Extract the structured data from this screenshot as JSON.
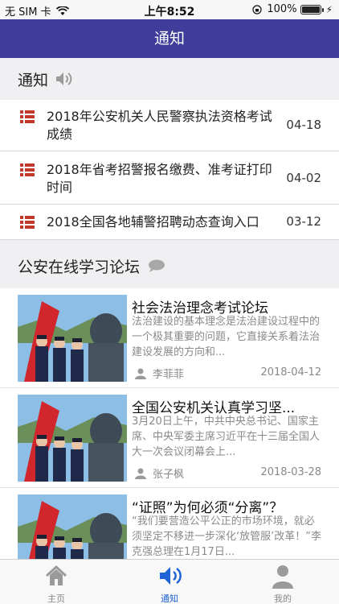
{
  "status_bar": {
    "carrier": "无 SIM 卡",
    "time": "上午8:52",
    "battery_text": "100%",
    "battery_level": 1.0
  },
  "nav": {
    "title": "通知"
  },
  "notices_section": {
    "title": "通知",
    "icon": "speaker-icon"
  },
  "notices": [
    {
      "title": "2018年公安机关人民警察执法资格考试成绩",
      "date": "04-18"
    },
    {
      "title": "2018年省考招警报名缴费、准考证打印时间",
      "date": "04-02"
    },
    {
      "title": "2018全国各地辅警招聘动态查询入口",
      "date": "03-12"
    }
  ],
  "forum_section": {
    "title": "公安在线学习论坛",
    "icon": "chat-bubble-icon"
  },
  "forum": [
    {
      "title": "社会法治理念考试论坛",
      "body": "法治建设的基本理念是法治建设过程中的一个极其重要的问题，它直接关系着法治建设发展的方向和...",
      "author": "李菲菲",
      "date": "2018-04-12"
    },
    {
      "title": "全国公安机关认真学习坚...",
      "body": "3月20日上午，中共中央总书记、国家主席、中央军委主席习近平在十三届全国人大一次会议闭幕会上...",
      "author": "张子枫",
      "date": "2018-03-28"
    },
    {
      "title": "“证照”为何必须“分离”？",
      "body": "“我们要营造公平公正的市场环境，就必须坚定不移进一步深化‘放管服’改革！”李克强总理在1月17日...",
      "author": "",
      "date": ""
    }
  ],
  "tabs": [
    {
      "label": "主页",
      "icon": "home-icon",
      "active": false
    },
    {
      "label": "通知",
      "icon": "speaker-icon",
      "active": true
    },
    {
      "label": "我的",
      "icon": "person-icon",
      "active": false
    }
  ],
  "colors": {
    "nav_bg": "#3f3d99",
    "accent": "#1e63d6",
    "list_icon": "#c0392b"
  }
}
